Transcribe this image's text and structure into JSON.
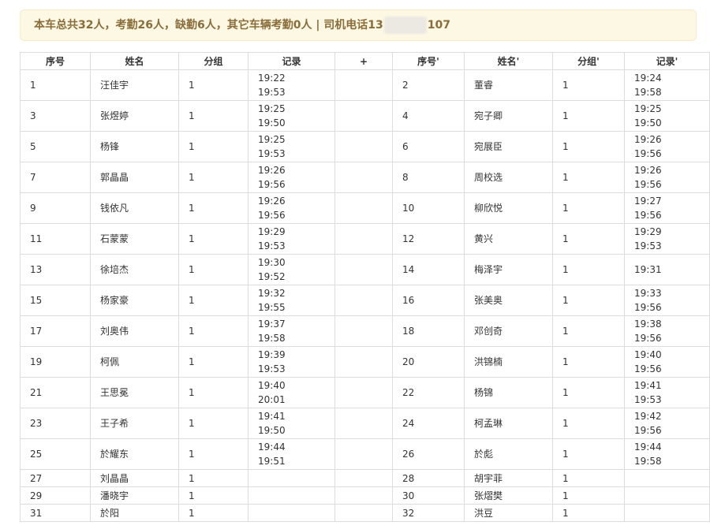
{
  "banner": {
    "text_before": "本车总共32人，考勤26人，缺勤6人，其它车辆考勤0人 | 司机电话13",
    "text_after": "107"
  },
  "table": {
    "headers": [
      "序号",
      "姓名",
      "分组",
      "记录",
      "+",
      "序号'",
      "姓名'",
      "分组'",
      "记录'"
    ],
    "rows": [
      {
        "l": {
          "no": "1",
          "name": "汪佳宇",
          "group": "1",
          "t1": "19:22",
          "t2": "19:53"
        },
        "r": {
          "no": "2",
          "name": "董睿",
          "group": "1",
          "t1": "19:24",
          "t2": "19:58"
        }
      },
      {
        "l": {
          "no": "3",
          "name": "张煜婷",
          "group": "1",
          "t1": "19:25",
          "t2": "19:50"
        },
        "r": {
          "no": "4",
          "name": "宛子卿",
          "group": "1",
          "t1": "19:25",
          "t2": "19:50"
        }
      },
      {
        "l": {
          "no": "5",
          "name": "杨锋",
          "group": "1",
          "t1": "19:25",
          "t2": "19:53"
        },
        "r": {
          "no": "6",
          "name": "宛展臣",
          "group": "1",
          "t1": "19:26",
          "t2": "19:56"
        }
      },
      {
        "l": {
          "no": "7",
          "name": "郭晶晶",
          "group": "1",
          "t1": "19:26",
          "t2": "19:56"
        },
        "r": {
          "no": "8",
          "name": "周校选",
          "group": "1",
          "t1": "19:26",
          "t2": "19:56"
        }
      },
      {
        "l": {
          "no": "9",
          "name": "钱依凡",
          "group": "1",
          "t1": "19:26",
          "t2": "19:56"
        },
        "r": {
          "no": "10",
          "name": "柳欣悦",
          "group": "1",
          "t1": "19:27",
          "t2": "19:56"
        }
      },
      {
        "l": {
          "no": "11",
          "name": "石蒙蒙",
          "group": "1",
          "t1": "19:29",
          "t2": "19:53"
        },
        "r": {
          "no": "12",
          "name": "黄兴",
          "group": "1",
          "t1": "19:29",
          "t2": "19:53"
        }
      },
      {
        "l": {
          "no": "13",
          "name": "徐培杰",
          "group": "1",
          "t1": "19:30",
          "t2": "19:52"
        },
        "r": {
          "no": "14",
          "name": "梅泽宇",
          "group": "1",
          "t1": "19:31",
          "t2": ""
        }
      },
      {
        "l": {
          "no": "15",
          "name": "杨家豪",
          "group": "1",
          "t1": "19:32",
          "t2": "19:55"
        },
        "r": {
          "no": "16",
          "name": "张美奥",
          "group": "1",
          "t1": "19:33",
          "t2": "19:56"
        }
      },
      {
        "l": {
          "no": "17",
          "name": "刘奥伟",
          "group": "1",
          "t1": "19:37",
          "t2": "19:58"
        },
        "r": {
          "no": "18",
          "name": "邓创奇",
          "group": "1",
          "t1": "19:38",
          "t2": "19:56"
        }
      },
      {
        "l": {
          "no": "19",
          "name": "柯佩",
          "group": "1",
          "t1": "19:39",
          "t2": "19:53"
        },
        "r": {
          "no": "20",
          "name": "洪锦楠",
          "group": "1",
          "t1": "19:40",
          "t2": "19:56"
        }
      },
      {
        "l": {
          "no": "21",
          "name": "王思冕",
          "group": "1",
          "t1": "19:40",
          "t2": "20:01"
        },
        "r": {
          "no": "22",
          "name": "杨锦",
          "group": "1",
          "t1": "19:41",
          "t2": "19:53"
        }
      },
      {
        "l": {
          "no": "23",
          "name": "王子希",
          "group": "1",
          "t1": "19:41",
          "t2": "19:50"
        },
        "r": {
          "no": "24",
          "name": "柯孟琳",
          "group": "1",
          "t1": "19:42",
          "t2": "19:56"
        }
      },
      {
        "l": {
          "no": "25",
          "name": "於耀东",
          "group": "1",
          "t1": "19:44",
          "t2": "19:51"
        },
        "r": {
          "no": "26",
          "name": "於彪",
          "group": "1",
          "t1": "19:44",
          "t2": "19:58"
        }
      },
      {
        "l": {
          "no": "27",
          "name": "刘晶晶",
          "group": "1",
          "t1": "",
          "t2": ""
        },
        "r": {
          "no": "28",
          "name": "胡宇菲",
          "group": "1",
          "t1": "",
          "t2": ""
        }
      },
      {
        "l": {
          "no": "29",
          "name": "潘晓宇",
          "group": "1",
          "t1": "",
          "t2": ""
        },
        "r": {
          "no": "30",
          "name": "张熠樊",
          "group": "1",
          "t1": "",
          "t2": ""
        }
      },
      {
        "l": {
          "no": "31",
          "name": "於阳",
          "group": "1",
          "t1": "",
          "t2": ""
        },
        "r": {
          "no": "32",
          "name": "洪豆",
          "group": "1",
          "t1": "",
          "t2": ""
        }
      }
    ]
  }
}
